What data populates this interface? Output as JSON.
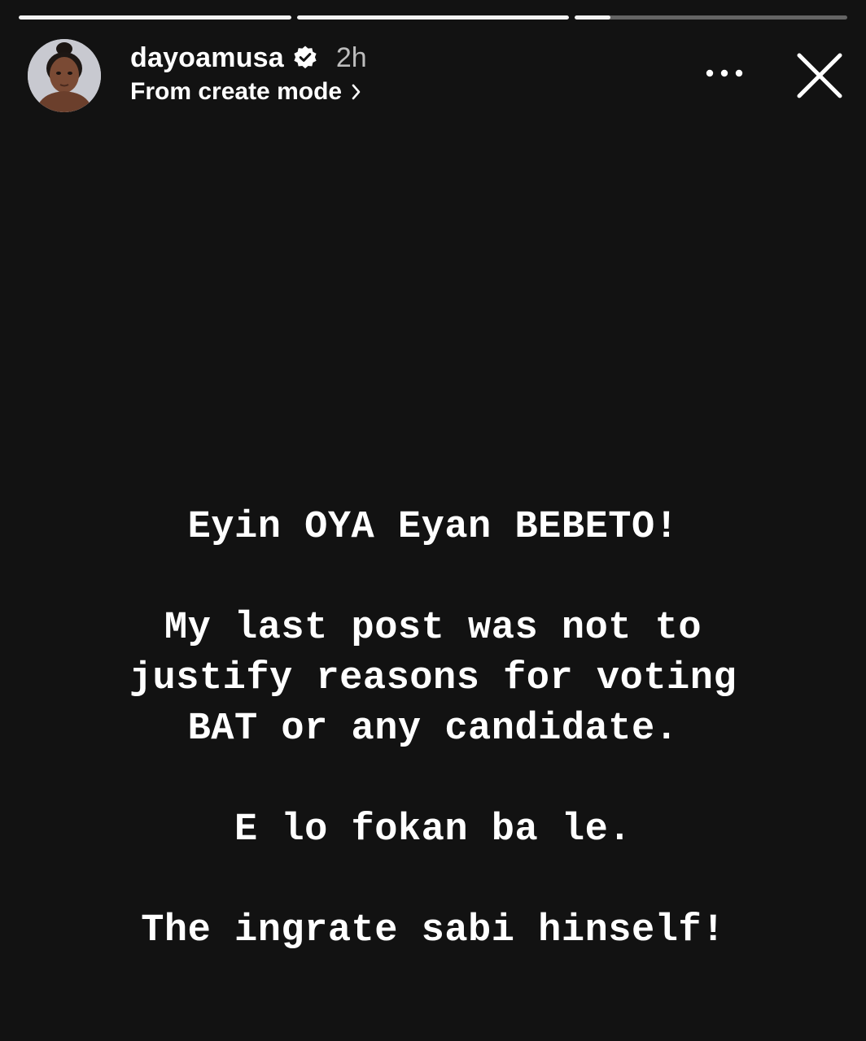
{
  "story": {
    "progress": [
      1.0,
      1.0,
      0.13
    ],
    "username": "dayoamusa",
    "verified": true,
    "time_ago": "2h",
    "subtitle": "From create mode",
    "text_paragraphs": [
      "Eyin OYA Eyan BEBETO!",
      "My last post was not to\njustify reasons for voting\nBAT or any candidate.",
      "E lo fokan ba le.",
      "The ingrate sabi hinself!"
    ]
  },
  "icons": {
    "verified": "verified-badge-icon",
    "chevron": "chevron-right-icon",
    "more": "more-options-icon",
    "close": "close-icon"
  },
  "colors": {
    "background": "#121212",
    "text": "#ffffff",
    "time": "#bdbdbd"
  }
}
